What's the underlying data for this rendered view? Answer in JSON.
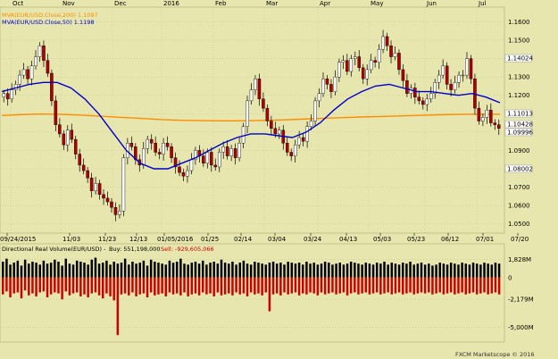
{
  "colors": {
    "background": "#e6e6ae",
    "grid": "#c8c890",
    "candle_up": "#ffffff",
    "candle_down": "#b00000",
    "wick": "#000000",
    "ma200": "#ff8c00",
    "ma50": "#0000cc",
    "buy_vol": "#000000",
    "sell_vol": "#cc0000"
  },
  "price_panel": {
    "legend_ma200": "MVA(EUR/USD.Close,200) 1.1097",
    "legend_ma50": "MVA(EUR/USD.Close,50) 1.1198",
    "y_ticks": [
      "1.1600",
      "1.1500",
      "1.1400",
      "1.1300",
      "1.1200",
      "1.1100",
      "1.1000",
      "1.0900",
      "1.0800",
      "1.0700",
      "1.0600",
      "1.0500"
    ],
    "price_labels": [
      "1.14024",
      "1.11013",
      "1.10428",
      "1.09996",
      "1.08002"
    ],
    "top_months": [
      "Oct",
      "Nov",
      "Dec",
      "2016",
      "Feb",
      "Mar",
      "Apr",
      "May",
      "Jun",
      "Jul"
    ],
    "bottom_dates": [
      "09/24/2015",
      "11/03",
      "11/23",
      "12/13",
      "01/05/2016",
      "01/25",
      "02/14",
      "03/04",
      "03/24",
      "04/13",
      "05/03",
      "05/23",
      "06/12",
      "07/01",
      "07/20"
    ]
  },
  "volume_panel": {
    "title": "Directional Real Volume(EUR/USD) -",
    "buy_text": "Buy: 551,198,000",
    "sell_text": "Sell: -929,605,066",
    "y_ticks": [
      "1,828M",
      "0",
      "-2,179M",
      "-5,000M"
    ]
  },
  "footer": "FXCM Marketscope © 2016",
  "chart_data": [
    {
      "type": "candlestick",
      "title": "EUR/USD",
      "ylim": [
        1.045,
        1.168
      ],
      "x_labels": [
        "09/24/2015",
        "11/03",
        "11/23",
        "12/13",
        "01/05/2016",
        "01/25",
        "02/14",
        "03/04",
        "03/24",
        "04/13",
        "05/03",
        "05/23",
        "06/12",
        "07/01",
        "07/20"
      ],
      "close_path": [
        1.121,
        1.118,
        1.123,
        1.126,
        1.131,
        1.134,
        1.129,
        1.136,
        1.141,
        1.147,
        1.139,
        1.132,
        1.117,
        1.104,
        1.099,
        1.093,
        1.101,
        1.096,
        1.088,
        1.082,
        1.079,
        1.075,
        1.068,
        1.072,
        1.066,
        1.064,
        1.062,
        1.059,
        1.055,
        1.057,
        1.086,
        1.094,
        1.092,
        1.085,
        1.082,
        1.091,
        1.096,
        1.094,
        1.089,
        1.088,
        1.094,
        1.092,
        1.086,
        1.081,
        1.078,
        1.076,
        1.079,
        1.085,
        1.09,
        1.087,
        1.083,
        1.089,
        1.082,
        1.081,
        1.089,
        1.092,
        1.087,
        1.091,
        1.086,
        1.094,
        1.103,
        1.117,
        1.123,
        1.129,
        1.118,
        1.113,
        1.106,
        1.102,
        1.099,
        1.101,
        1.094,
        1.089,
        1.087,
        1.093,
        1.097,
        1.095,
        1.103,
        1.106,
        1.117,
        1.121,
        1.129,
        1.126,
        1.122,
        1.13,
        1.138,
        1.139,
        1.133,
        1.14,
        1.141,
        1.135,
        1.129,
        1.134,
        1.139,
        1.138,
        1.145,
        1.152,
        1.147,
        1.141,
        1.143,
        1.134,
        1.128,
        1.121,
        1.124,
        1.119,
        1.117,
        1.115,
        1.118,
        1.121,
        1.127,
        1.131,
        1.136,
        1.126,
        1.123,
        1.127,
        1.131,
        1.131,
        1.14,
        1.129,
        1.113,
        1.106,
        1.108,
        1.112,
        1.105,
        1.104,
        1.102
      ],
      "series": [
        {
          "name": "MVA(EUR/USD.Close,50)",
          "values": [
            1.122,
            1.124,
            1.126,
            1.127,
            1.127,
            1.124,
            1.118,
            1.11,
            1.1,
            1.09,
            1.083,
            1.08,
            1.08,
            1.083,
            1.086,
            1.09,
            1.094,
            1.097,
            1.099,
            1.099,
            1.098,
            1.097,
            1.1,
            1.105,
            1.112,
            1.118,
            1.122,
            1.125,
            1.126,
            1.124,
            1.122,
            1.122,
            1.121,
            1.12,
            1.121,
            1.119,
            1.116
          ]
        },
        {
          "name": "MVA(EUR/USD.Close,200)",
          "values": [
            1.109,
            1.1095,
            1.1098,
            1.1096,
            1.1092,
            1.1086,
            1.108,
            1.1074,
            1.1068,
            1.1064,
            1.1062,
            1.1061,
            1.1061,
            1.1063,
            1.1066,
            1.107,
            1.1074,
            1.1078,
            1.1082,
            1.1085,
            1.1088,
            1.1091,
            1.1094,
            1.1096,
            1.1097,
            1.1097
          ]
        }
      ]
    },
    {
      "type": "bar",
      "title": "Directional Real Volume(EUR/USD)",
      "series": [
        {
          "name": "Buy",
          "values_m": [
            1.6,
            1.9,
            1.3,
            1.5,
            1.7,
            1.2,
            1.8,
            1.4,
            1.6,
            1.5,
            1.3,
            1.7,
            1.4,
            1.5,
            1.8,
            1.6,
            1.2,
            1.9,
            1.4,
            1.3,
            1.7,
            1.6,
            1.5,
            1.3,
            1.8,
            2.0,
            1.4,
            1.5,
            1.7,
            1.3,
            1.6,
            1.4,
            1.5,
            1.9,
            1.3,
            1.6,
            1.4,
            1.5,
            1.7,
            1.2,
            1.8,
            1.6,
            1.5,
            1.4,
            1.3,
            1.7,
            1.5,
            1.6,
            1.9,
            1.4,
            1.3,
            1.5,
            1.6,
            1.4,
            1.7,
            1.3,
            1.5,
            1.6,
            1.4,
            1.8,
            1.5,
            1.4,
            1.6,
            1.3,
            1.5,
            1.7,
            1.4,
            1.3,
            1.6,
            1.5,
            1.4,
            1.3,
            1.5,
            1.6,
            1.4,
            1.5,
            1.3,
            1.6,
            1.5,
            1.4,
            1.5,
            1.3,
            1.6,
            1.4,
            1.5,
            1.3,
            1.4,
            1.6,
            1.5,
            1.3,
            1.4,
            1.5,
            1.3,
            1.4,
            1.6,
            1.5,
            1.4,
            1.3,
            1.5,
            1.4,
            1.3,
            1.5,
            1.4,
            1.6,
            1.3,
            1.5,
            1.4,
            1.3,
            1.5,
            1.4,
            1.6,
            1.3,
            1.4,
            1.5,
            1.3,
            1.4,
            1.2,
            1.3,
            1.5,
            1.4,
            1.3,
            1.5,
            1.4,
            1.3,
            1.5,
            1.4,
            1.3,
            1.5,
            1.4,
            1.3,
            1.5,
            1.4,
            1.3,
            1.5,
            1.4
          ]
        },
        {
          "name": "Sell",
          "values_m": [
            -1.7,
            -1.4,
            -2.0,
            -1.6,
            -1.5,
            -2.1,
            -1.3,
            -1.8,
            -1.6,
            -1.9,
            -1.5,
            -1.4,
            -2.0,
            -1.7,
            -1.5,
            -1.6,
            -2.2,
            -1.4,
            -1.8,
            -1.6,
            -1.5,
            -1.9,
            -1.7,
            -2.0,
            -1.6,
            -1.5,
            -1.8,
            -2.1,
            -1.6,
            -1.9,
            -2.3,
            -5.8,
            -1.7,
            -1.6,
            -1.8,
            -1.5,
            -1.9,
            -1.7,
            -1.6,
            -2.0,
            -1.5,
            -1.8,
            -1.7,
            -1.6,
            -1.9,
            -1.5,
            -1.7,
            -1.6,
            -1.8,
            -1.5,
            -1.9,
            -1.7,
            -1.6,
            -1.8,
            -1.5,
            -1.7,
            -1.6,
            -1.9,
            -1.5,
            -1.8,
            -1.7,
            -1.6,
            -1.8,
            -1.5,
            -1.7,
            -1.6,
            -1.9,
            -1.5,
            -1.7,
            -1.6,
            -1.8,
            -1.5,
            -3.4,
            -1.7,
            -1.6,
            -1.8,
            -1.5,
            -1.7,
            -1.6,
            -1.5,
            -1.8,
            -1.6,
            -1.7,
            -1.5,
            -1.6,
            -1.8,
            -1.5,
            -1.7,
            -1.6,
            -1.5,
            -1.7,
            -1.6,
            -1.5,
            -1.8,
            -1.6,
            -1.5,
            -1.7,
            -1.6,
            -1.5,
            -1.7,
            -1.6,
            -1.5,
            -1.7,
            -1.6,
            -1.5,
            -1.7,
            -1.6,
            -1.5,
            -1.7,
            -1.6,
            -1.5,
            -1.7,
            -1.6,
            -1.5,
            -1.6,
            -1.5,
            -1.7,
            -1.6,
            -1.5,
            -1.7,
            -1.6,
            -1.5,
            -1.7,
            -1.6,
            -1.5,
            -1.7,
            -1.6,
            -1.5,
            -1.7,
            -1.6,
            -1.5,
            -1.7,
            -1.6,
            -1.5,
            -1.7
          ]
        }
      ],
      "ylim_m": [
        -6.5,
        2.5
      ]
    }
  ]
}
